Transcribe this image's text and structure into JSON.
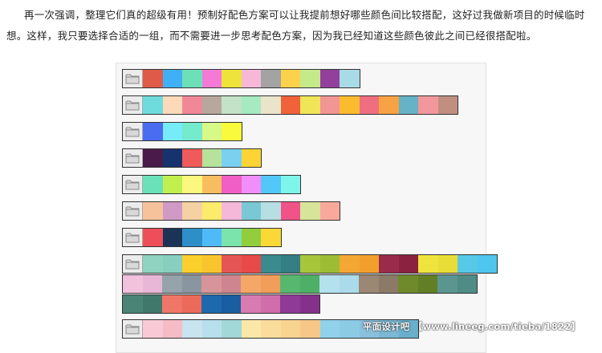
{
  "article": {
    "text": "再一次强调，整理它们真的超级有用！预制好配色方案可以让我提前想好哪些颜色间比较搭配，这好过我做新项目的时候临时想。这样，我只要选择合适的一组，而不需要进一步思考配色方案，因为我已经知道这些颜色彼此之间已经很搭配啦。"
  },
  "palettes": [
    {
      "colors": [
        "#e05a48",
        "#3fb0f5",
        "#6ee0b8",
        "#f47ad6",
        "#ede33a",
        "#f7b8d8",
        "#a3a3a3",
        "#fcd24c",
        "#c4ea8a",
        "#93409c",
        "#a9dbe6"
      ]
    },
    {
      "colors": [
        "#6edcdc",
        "#fcd9b8",
        "#f08898",
        "#b8a79c",
        "#c4e2c7",
        "#a6eac1",
        "#eae4cb",
        "#f0623a",
        "#f0e557",
        "#f29595",
        "#fbbb30",
        "#ef6f81",
        "#f7a243",
        "#66b2c6",
        "#f2979c",
        "#c08f80"
      ]
    },
    {
      "colors": [
        "#4a6cf0",
        "#76ebf9",
        "#75eacc",
        "#d6f987",
        "#f8fa3b"
      ]
    },
    {
      "colors": [
        "#4a1b4a",
        "#16336e",
        "#ef5a5a",
        "#b6e29b",
        "#79d0ef",
        "#fdd433"
      ]
    },
    {
      "colors": [
        "#6ae1b8",
        "#c1ef4e",
        "#fcf77e",
        "#f8bd5f",
        "#f05ec6",
        "#f18ef9",
        "#53c7f8",
        "#7ef5ea"
      ]
    },
    {
      "colors": [
        "#f6c29c",
        "#d19ac6",
        "#f6d1a3",
        "#fdeb6b",
        "#f5b8d9",
        "#79c8d3",
        "#b7dee2",
        "#ef5387",
        "#d6e59a",
        "#f8a99b"
      ]
    },
    {
      "colors": [
        "#ee4e5a",
        "#1a3357",
        "#2e8ec8",
        "#4fbaf8",
        "#7be4ad",
        "#92cd3b",
        "#fad937"
      ]
    },
    {
      "colors": [
        "#8fd3c1",
        "#88cfc0",
        "#fbcf2c",
        "#f9c52f",
        "#e65555",
        "#e84a4a",
        "#3a8a8e",
        "#357e84",
        "#a8c63a",
        "#9dbd35",
        "#f4a734",
        "#f29f2e",
        "#9a2b4a",
        "#8a2240",
        "#efe43e",
        "#e8dd38",
        "#56c9e6",
        "#4ec6ef",
        "#f2c2dd",
        "#e8b6d6",
        "#96a3ab",
        "#8a969f",
        "#d8949b",
        "#cf8590",
        "#f5a767",
        "#f29d5a",
        "#57b76e",
        "#4eaf66",
        "#b5e0ee",
        "#abdbea",
        "#9a8774",
        "#8c7a68",
        "#6e8a2a",
        "#637f25",
        "#5a968f",
        "#4f8c86",
        "#4a8477",
        "#41786c",
        "#f07768",
        "#ec6a5a",
        "#1e68ae",
        "#1a5ea2",
        "#d77bb1",
        "#cf6ea8",
        "#8f3a96",
        "#85318c"
      ]
    },
    {
      "colors": [
        "#f9cad6",
        "#f6bcc6",
        "#c8e4ef",
        "#b8e0ec",
        "#a3d8d8",
        "#fbe8a8",
        "#fadd9c",
        "#f9d390",
        "#f6c789",
        "#8fd2ea",
        "#8ccbe4",
        "#89c1dd",
        "#7ab8d4",
        "#6aafcc"
      ]
    }
  ],
  "watermark": {
    "text": "平面设计吧 【www.lineeg.com/tieba/1822】"
  }
}
